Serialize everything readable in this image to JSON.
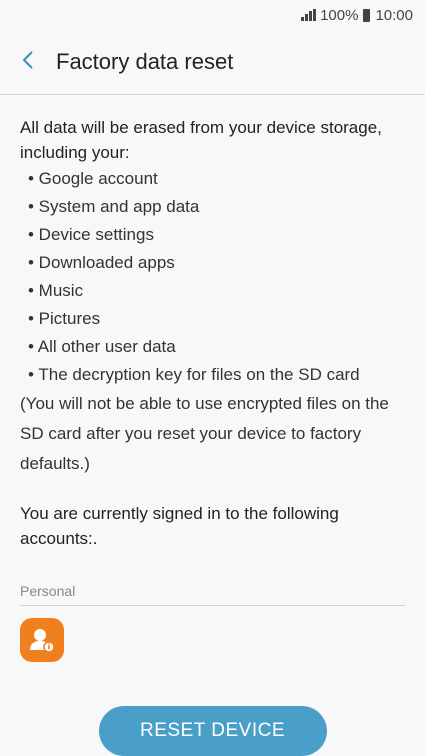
{
  "status_bar": {
    "battery": "100%",
    "time": "10:00"
  },
  "header": {
    "title": "Factory data reset",
    "back_icon": "chevron-left-icon"
  },
  "intro": "All data will be erased from your device storage, including your:",
  "items": [
    "• Google account",
    "• System and app data",
    "• Device settings",
    "• Downloaded apps",
    "• Music",
    "• Pictures",
    "• All other user data",
    "• The decryption key for files on the SD card"
  ],
  "sd_note": "(You will not be able to use encrypted files on the SD card after you reset your device to factory defaults.)",
  "signed_in_text": "You are currently signed in to the following accounts:.",
  "accounts_section": {
    "label": "Personal",
    "icon": "samsung-account-icon",
    "icon_color": "#f0801e"
  },
  "reset_button": {
    "label": "RESET DEVICE",
    "color": "#4a9fc9"
  }
}
